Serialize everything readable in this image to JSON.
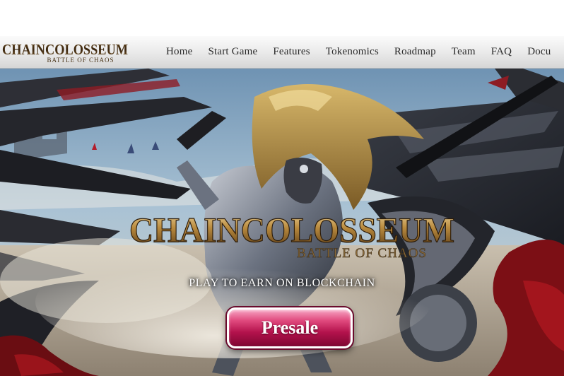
{
  "brand": {
    "logo_main": "ChainColosseum",
    "logo_sub": "BATTLE OF CHAOS"
  },
  "nav": {
    "items": [
      "Home",
      "Start Game",
      "Features",
      "Tokenomics",
      "Roadmap",
      "Team",
      "FAQ",
      "Docu"
    ]
  },
  "hero": {
    "title_main": "ChainColosseum",
    "title_sub": "BATTLE OF CHAOS",
    "tagline": "PLAY TO EARN ON BLOCKCHAIN",
    "cta_label": "Presale"
  },
  "colors": {
    "cta": "#b3124c",
    "title_gold": "#c79a4a",
    "nav_text": "#2a2a2a"
  },
  "icons": [
    "winged-warrior-illustration",
    "axe-blade-icon"
  ]
}
